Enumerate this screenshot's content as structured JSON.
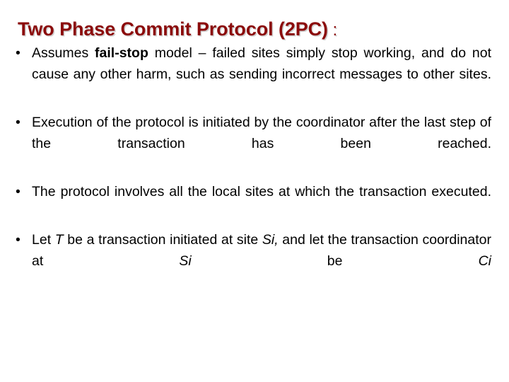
{
  "slide": {
    "title": {
      "main": "Two Phase Commit Protocol (2PC)",
      "colon": " :",
      "color": "#8B0A0A",
      "shadow_color": "#C8C8C8"
    },
    "background_color": "#FFFFFF",
    "text_color": "#000000",
    "bullet_marker": "•",
    "bullets": [
      {
        "id": "bullet-fail-stop",
        "segments": [
          {
            "text": "Assumes ",
            "style": "normal"
          },
          {
            "text": "fail-stop",
            "style": "bold"
          },
          {
            "text": " model – failed sites simply stop working, and do not cause any other harm, such as sending incorrect messages to other sites.",
            "style": "normal"
          }
        ],
        "plain_text": "Assumes fail-stop model – failed sites simply stop working, and do not cause any other harm, such as sending incorrect messages to other sites."
      },
      {
        "id": "bullet-execution",
        "segments": [
          {
            "text": "Execution of the protocol is initiated by the coordinator after the last step of the transaction has been reached.",
            "style": "normal"
          }
        ],
        "plain_text": "Execution of the protocol is initiated by the coordinator after the last step of the transaction has been reached."
      },
      {
        "id": "bullet-local-sites",
        "segments": [
          {
            "text": "The protocol involves all the local sites at which the transaction executed.",
            "style": "normal"
          }
        ],
        "plain_text": "The protocol involves all the local sites at which the transaction executed."
      },
      {
        "id": "bullet-transaction-coordinator",
        "segments": [
          {
            "text": "Let ",
            "style": "normal"
          },
          {
            "text": "T",
            "style": "italic"
          },
          {
            "text": " be a transaction initiated at site ",
            "style": "normal"
          },
          {
            "text": "Si,",
            "style": "italic"
          },
          {
            "text": " and let the transaction coordinator at ",
            "style": "normal"
          },
          {
            "text": "Si",
            "style": "italic"
          },
          {
            "text": " be ",
            "style": "normal"
          },
          {
            "text": "Ci",
            "style": "italic"
          }
        ],
        "plain_text": "Let T be a transaction initiated at site Si, and let the transaction coordinator at Si be Ci"
      }
    ]
  }
}
